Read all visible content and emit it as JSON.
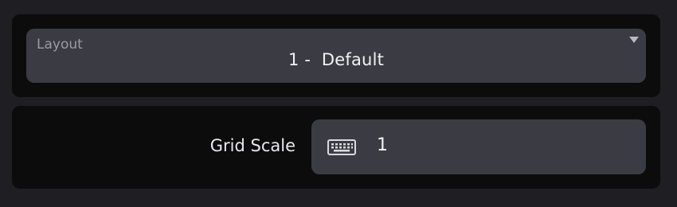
{
  "layout": {
    "label": "Layout",
    "value": "1 -  Default",
    "caret_icon": "caret-down-icon"
  },
  "grid_scale": {
    "label": "Grid Scale",
    "value": "1",
    "icon": "keyboard-icon"
  },
  "colors": {
    "background": "#1f1f23",
    "panel": "#0c0c0d",
    "field": "#3b3b43",
    "text": "#f2f2f4",
    "muted": "#9b9ba3"
  }
}
